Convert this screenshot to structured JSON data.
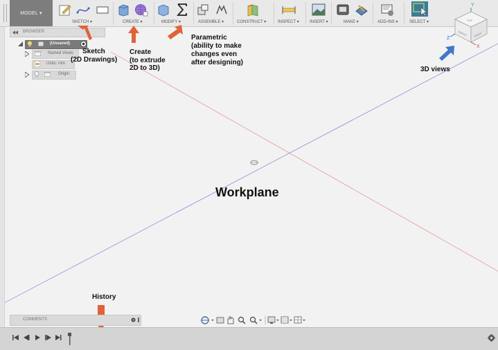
{
  "toolbar": {
    "model_label": "MODEL ▾",
    "sections": [
      {
        "label": "SKETCH ▾"
      },
      {
        "label": "CREATE ▾"
      },
      {
        "label": "MODIFY ▾"
      },
      {
        "label": "ASSEMBLE ▾"
      },
      {
        "label": "CONSTRUCT ▾"
      },
      {
        "label": "INSPECT ▾"
      },
      {
        "label": "INSERT ▾"
      },
      {
        "label": "MAKE ▾"
      },
      {
        "label": "ADD-INS ▾"
      },
      {
        "label": "SELECT ▾"
      }
    ]
  },
  "browser": {
    "title": "BROWSER",
    "root": "(Unsaved)",
    "items": [
      "Named Views",
      "Units: mm",
      "Origin"
    ]
  },
  "viewcube": {
    "faces": [
      "TOP",
      "FRONT",
      "RIGHT"
    ],
    "axes": [
      "Y",
      "Z",
      "X"
    ]
  },
  "annotations": {
    "sketch": "Sketch",
    "sketch_sub": "(2D Drawings)",
    "create": "Create",
    "create_sub1": "(to extrude",
    "create_sub2": "2D to 3D)",
    "parametric": "Parametric",
    "parametric_sub1": "(ability to make",
    "parametric_sub2": "changes even",
    "parametric_sub3": "after designing)",
    "views": "3D views",
    "workplane": "Workplane",
    "history": "History"
  },
  "comments": {
    "title": "COMMENTS"
  },
  "colors": {
    "arrow_orange": "#e0623a",
    "arrow_blue": "#3f79c9",
    "axis_red": "#e58d8d",
    "axis_blue": "#7a82d6"
  }
}
